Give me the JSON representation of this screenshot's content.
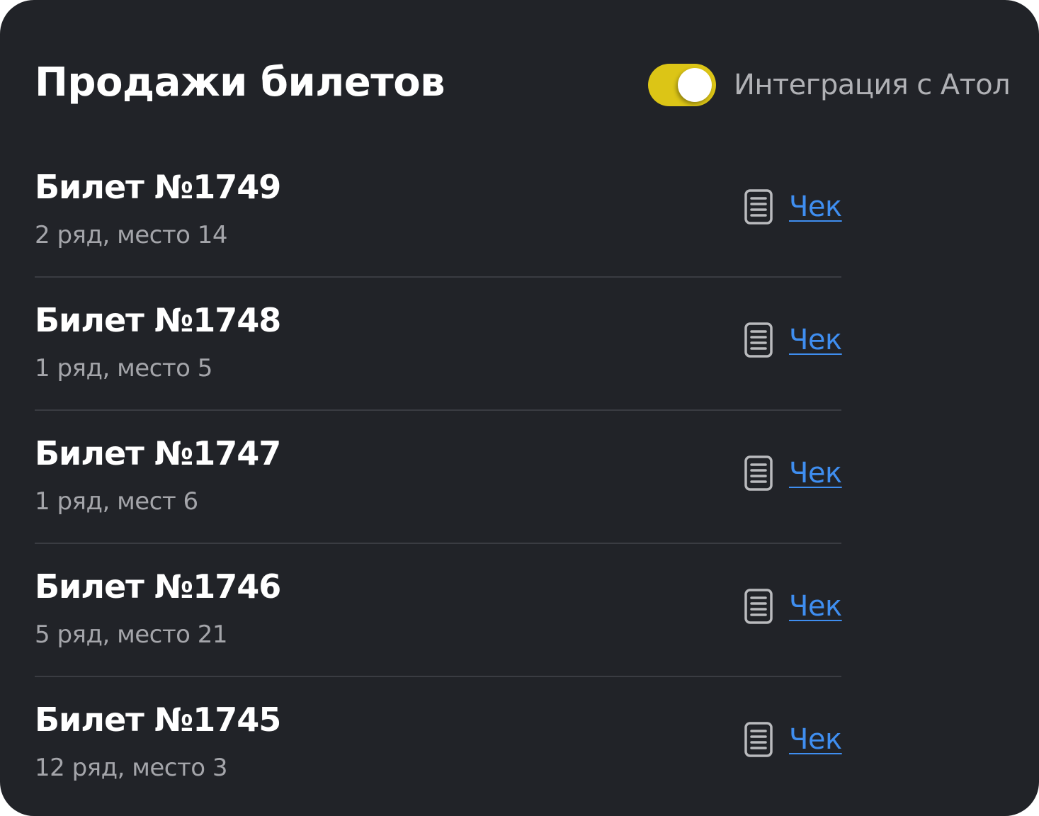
{
  "header": {
    "title": "Продажи билетов",
    "integration_label": "Интеграция с Атол",
    "integration_enabled": true
  },
  "colors": {
    "background": "#212328",
    "toggle_on": "#dcc516",
    "link": "#3f8ef0"
  },
  "tickets": [
    {
      "name": "Билет №1749",
      "seat": "2 ряд, место 14",
      "receipt_label": "Чек",
      "receipt_icon": "document-icon"
    },
    {
      "name": "Билет №1748",
      "seat": "1 ряд, место 5",
      "receipt_label": "Чек",
      "receipt_icon": "document-icon"
    },
    {
      "name": "Билет №1747",
      "seat": "1 ряд, мест 6",
      "receipt_label": "Чек",
      "receipt_icon": "document-icon"
    },
    {
      "name": "Билет №1746",
      "seat": "5 ряд, место 21",
      "receipt_label": "Чек",
      "receipt_icon": "document-icon"
    },
    {
      "name": "Билет №1745",
      "seat": "12 ряд, место 3",
      "receipt_label": "Чек",
      "receipt_icon": "document-icon"
    }
  ]
}
